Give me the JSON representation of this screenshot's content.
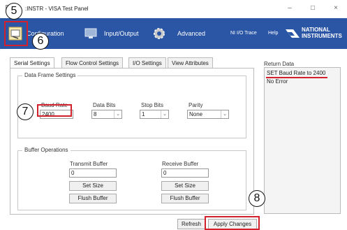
{
  "window": {
    "title": ":INSTR - VISA Test Panel",
    "minimize": "–",
    "maximize": "□",
    "close": "×"
  },
  "toolbar": {
    "configuration_label": "Configuration",
    "input_output_label": "Input/Output",
    "advanced_label": "Advanced",
    "ni_io_trace_label": "NI I/O Trace",
    "help_label": "Help",
    "brand_line1": "NATIONAL",
    "brand_line2": "INSTRUMENTS",
    "color": "#2b56a6"
  },
  "tabs": [
    {
      "label": "Serial Settings",
      "active": true
    },
    {
      "label": "Flow Control Settings",
      "active": false
    },
    {
      "label": "I/O Settings",
      "active": false
    },
    {
      "label": "View Attributes",
      "active": false
    }
  ],
  "data_frame": {
    "legend": "Data Frame Settings",
    "baud_rate_label": "Baud Rate",
    "baud_rate_value": "2400",
    "data_bits_label": "Data Bits",
    "data_bits_value": "8",
    "stop_bits_label": "Stop Bits",
    "stop_bits_value": "1",
    "parity_label": "Parity",
    "parity_value": "None"
  },
  "buffer": {
    "legend": "Buffer Operations",
    "transmit_label": "Transmit Buffer",
    "transmit_value": "0",
    "receive_label": "Receive Buffer",
    "receive_value": "0",
    "set_size_label": "Set Size",
    "flush_label": "Flush Buffer"
  },
  "return_data": {
    "label": "Return Data",
    "lines": [
      "SET Baud Rate to 2400",
      "No Error"
    ]
  },
  "actions": {
    "refresh_label": "Refresh",
    "apply_label": "Apply Changes"
  },
  "callouts": [
    "5",
    "6",
    "7",
    "8"
  ],
  "highlight_color": "#d4202a"
}
